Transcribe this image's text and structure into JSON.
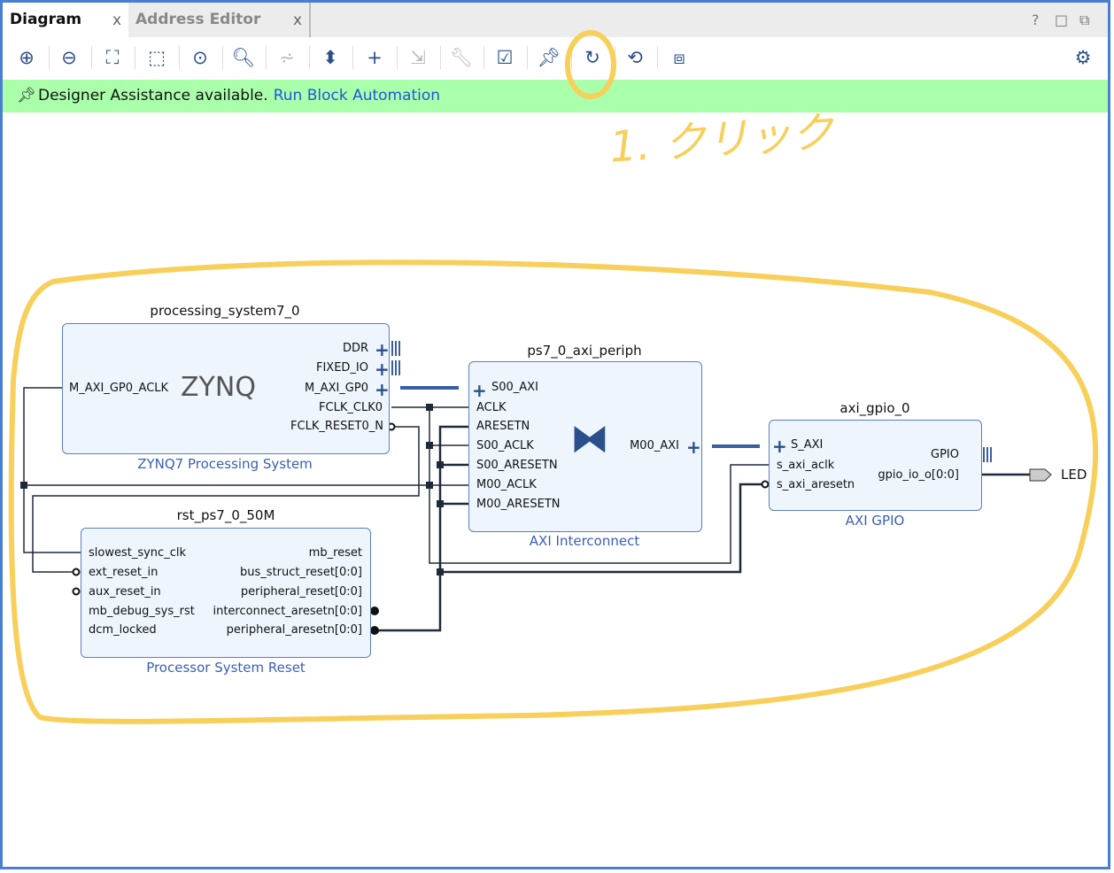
{
  "tabs": [
    {
      "label": "Diagram",
      "close": "x"
    },
    {
      "label": "Address Editor",
      "close": "x"
    }
  ],
  "window_buttons": [
    "?",
    "□",
    "⧉"
  ],
  "toolbar": [
    {
      "name": "zoom-in-icon",
      "g": "⊕"
    },
    {
      "name": "zoom-out-icon",
      "g": "⊖"
    },
    {
      "name": "zoom-fit-icon",
      "g": "⛶"
    },
    {
      "name": "zoom-area-icon",
      "g": "⬚"
    },
    {
      "name": "auto-connect-icon",
      "g": "⊙"
    },
    {
      "name": "search-icon",
      "g": "🔍︎"
    },
    {
      "name": "collapse-icon",
      "g": "⩫"
    },
    {
      "name": "expand-icon",
      "g": "⬍"
    },
    {
      "name": "add-ip-icon",
      "g": "+"
    },
    {
      "name": "make-external-icon",
      "g": "⇲"
    },
    {
      "name": "properties-wrench-icon",
      "g": "🔧︎"
    },
    {
      "name": "validate-icon",
      "g": "☑"
    },
    {
      "name": "pin-icon",
      "g": "📌︎"
    },
    {
      "name": "regenerate-layout-icon",
      "g": "↻"
    },
    {
      "name": "optimize-routing-icon",
      "g": "⟲"
    },
    {
      "name": "add-module-icon",
      "g": "⧈"
    }
  ],
  "settings_icon": "gear-icon",
  "banner": {
    "text": "Designer Assistance available.",
    "link": "Run Block Automation"
  },
  "annotation": {
    "text": "1. クリック",
    "color": "#f7cf5a"
  },
  "blocks": {
    "ps7": {
      "name": "processing_system7_0",
      "type": "ZYNQ7 Processing System",
      "logo": "ZYNQ",
      "left_ports": [
        "M_AXI_GP0_ACLK"
      ],
      "right_ports": [
        "DDR",
        "FIXED_IO",
        "M_AXI_GP0",
        "FCLK_CLK0",
        "FCLK_RESET0_N"
      ]
    },
    "ic": {
      "name": "ps7_0_axi_periph",
      "type": "AXI Interconnect",
      "left_ports": [
        "S00_AXI",
        "ACLK",
        "ARESETN",
        "S00_ACLK",
        "S00_ARESETN",
        "M00_ACLK",
        "M00_ARESETN"
      ],
      "right_ports": [
        "M00_AXI"
      ]
    },
    "gpio": {
      "name": "axi_gpio_0",
      "type": "AXI GPIO",
      "left_ports": [
        "S_AXI",
        "s_axi_aclk",
        "s_axi_aresetn"
      ],
      "right_ports": [
        "GPIO",
        "gpio_io_o[0:0]"
      ]
    },
    "rst": {
      "name": "rst_ps7_0_50M",
      "type": "Processor System Reset",
      "left_ports": [
        "slowest_sync_clk",
        "ext_reset_in",
        "aux_reset_in",
        "mb_debug_sys_rst",
        "dcm_locked"
      ],
      "right_ports": [
        "mb_reset",
        "bus_struct_reset[0:0]",
        "peripheral_reset[0:0]",
        "interconnect_aresetn[0:0]",
        "peripheral_aresetn[0:0]"
      ]
    }
  },
  "external_port": "LED"
}
